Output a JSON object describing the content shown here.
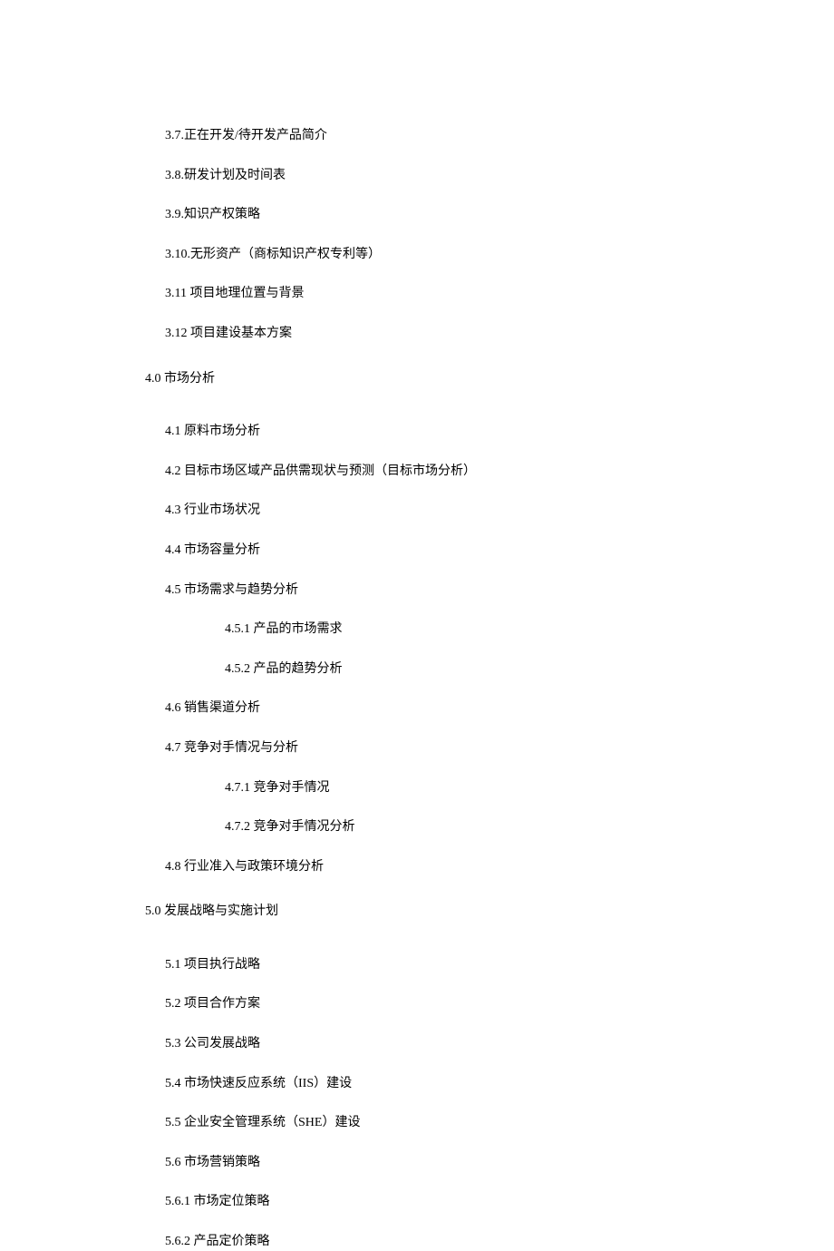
{
  "items": [
    {
      "level": 2,
      "text": "3.7.正在开发/待开发产品简介"
    },
    {
      "level": 2,
      "text": "3.8.研发计划及时间表"
    },
    {
      "level": 2,
      "text": "3.9.知识产权策略"
    },
    {
      "level": 2,
      "text": "3.10.无形资产（商标知识产权专利等）"
    },
    {
      "level": 2,
      "text": "3.11 项目地理位置与背景"
    },
    {
      "level": 2,
      "text": "3.12 项目建设基本方案"
    },
    {
      "level": 1,
      "text": "4.0 市场分析"
    },
    {
      "level": 2,
      "text": "4.1 原料市场分析"
    },
    {
      "level": 2,
      "text": "4.2 目标市场区域产品供需现状与预测（目标市场分析）"
    },
    {
      "level": 2,
      "text": "4.3 行业市场状况"
    },
    {
      "level": 2,
      "text": "4.4 市场容量分析"
    },
    {
      "level": 2,
      "text": "4.5 市场需求与趋势分析"
    },
    {
      "level": 3,
      "text": "4.5.1 产品的市场需求"
    },
    {
      "level": 3,
      "text": "4.5.2 产品的趋势分析"
    },
    {
      "level": 2,
      "text": "4.6 销售渠道分析"
    },
    {
      "level": 2,
      "text": "4.7 竞争对手情况与分析"
    },
    {
      "level": 3,
      "text": "4.7.1 竞争对手情况"
    },
    {
      "level": 3,
      "text": "4.7.2 竞争对手情况分析"
    },
    {
      "level": 2,
      "text": "4.8 行业准入与政策环境分析"
    },
    {
      "level": 1,
      "text": "5.0 发展战略与实施计划"
    },
    {
      "level": 2,
      "text": "5.1 项目执行战略"
    },
    {
      "level": 2,
      "text": "5.2 项目合作方案"
    },
    {
      "level": 2,
      "text": "5.3 公司发展战略"
    },
    {
      "level": 2,
      "text": "5.4 市场快速反应系统（IIS）建设"
    },
    {
      "level": 2,
      "text": "5.5 企业安全管理系统（SHE）建设"
    },
    {
      "level": 2,
      "text": "5.6 市场营销策略"
    },
    {
      "level": 2,
      "text": "5.6.1 市场定位策略"
    },
    {
      "level": 2,
      "text": "5.6.2 产品定价策略"
    }
  ]
}
